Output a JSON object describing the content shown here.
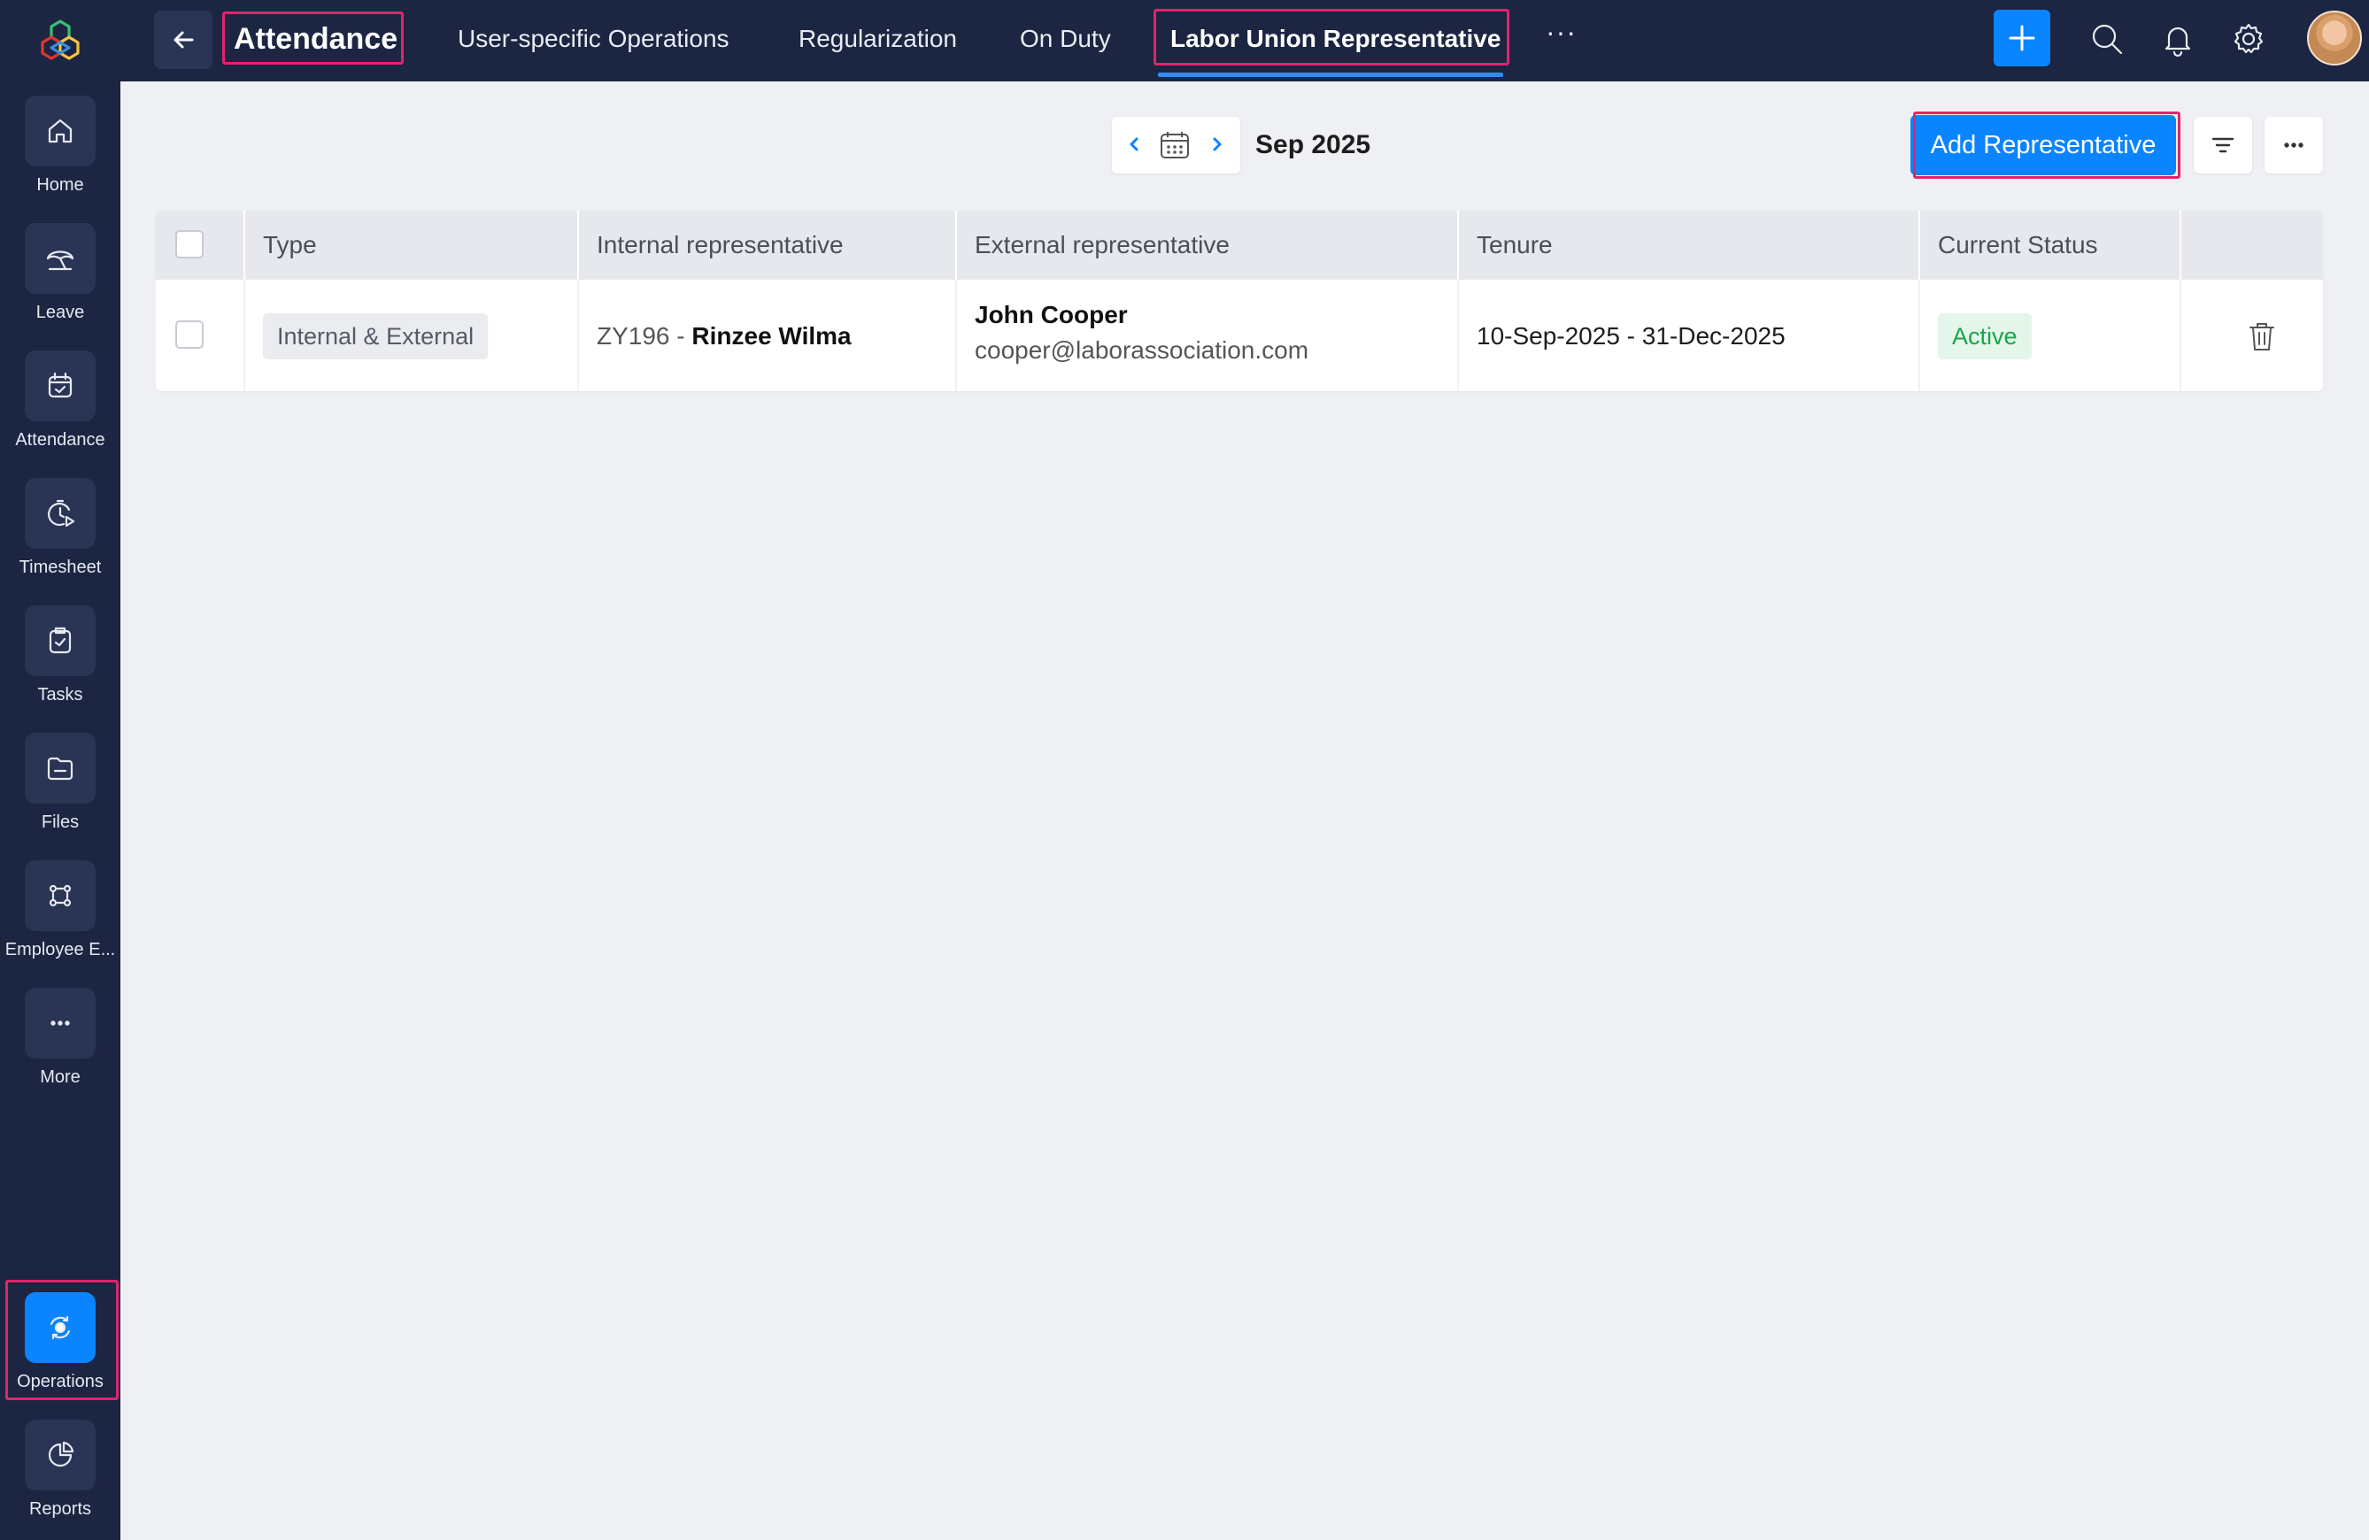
{
  "app": {
    "module_title": "Attendance",
    "colors": {
      "sidebar": "#1c2541",
      "accent": "#0b84ff",
      "highlight": "#e1246c",
      "status_active": "#1aa44b"
    }
  },
  "sidebar": {
    "items": [
      {
        "label": "Home",
        "icon": "home-icon"
      },
      {
        "label": "Leave",
        "icon": "umbrella-icon"
      },
      {
        "label": "Attendance",
        "icon": "calendar-check-icon"
      },
      {
        "label": "Timesheet",
        "icon": "timer-icon"
      },
      {
        "label": "Tasks",
        "icon": "clipboard-check-icon"
      },
      {
        "label": "Files",
        "icon": "folder-icon"
      },
      {
        "label": "Employee E...",
        "icon": "engagement-icon"
      },
      {
        "label": "More",
        "icon": "more-icon"
      },
      {
        "label": "Operations",
        "icon": "operations-icon"
      },
      {
        "label": "Reports",
        "icon": "pie-chart-icon"
      }
    ]
  },
  "topbar": {
    "tabs": [
      {
        "label": "User-specific Operations"
      },
      {
        "label": "Regularization"
      },
      {
        "label": "On Duty"
      },
      {
        "label": "Labor Union Representative"
      }
    ],
    "more_label": "···"
  },
  "toolbar": {
    "period": "Sep 2025",
    "add_label": "Add Representative"
  },
  "table": {
    "columns": [
      "Type",
      "Internal representative",
      "External representative",
      "Tenure",
      "Current Status"
    ],
    "rows": [
      {
        "type": "Internal & External",
        "internal_id": "ZY196 - ",
        "internal_name": "Rinzee Wilma",
        "external_name": "John Cooper",
        "external_email": "cooper@laborassociation.com",
        "tenure": "10-Sep-2025 - 31-Dec-2025",
        "status": "Active"
      }
    ]
  }
}
